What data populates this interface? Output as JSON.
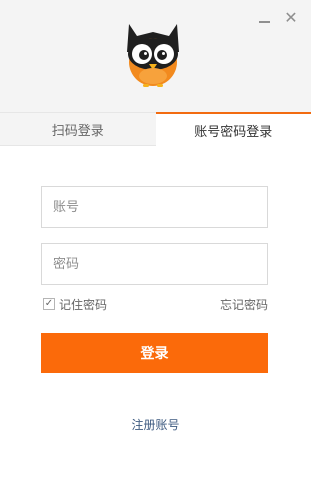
{
  "window": {
    "minimize_icon": "minimize-icon",
    "close_icon": "close-icon",
    "close_glyph": "✕"
  },
  "logo": {
    "icon": "owl-logo",
    "colors": {
      "body": "#f28a1e",
      "head": "#1f1f1f",
      "eye_white": "#ffffff"
    }
  },
  "tabs": [
    {
      "label": "扫码登录",
      "active": false
    },
    {
      "label": "账号密码登录",
      "active": true
    }
  ],
  "form": {
    "account_placeholder": "账号",
    "password_placeholder": "密码",
    "remember_label": "记住密码",
    "remember_checked": true,
    "check_glyph": "✓",
    "forgot_label": "忘记密码",
    "login_label": "登录"
  },
  "footer": {
    "register_label": "注册账号"
  },
  "colors": {
    "accent": "#fb6a0a",
    "tab_underline": "#f26b10",
    "link": "#3d5a80"
  }
}
